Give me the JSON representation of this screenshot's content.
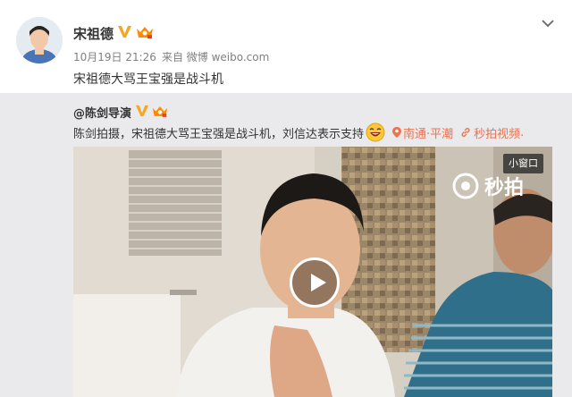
{
  "post": {
    "author": "宋祖德",
    "timestamp": "10月19日 21:26",
    "source": "来自 微博 weibo.com",
    "text": "宋祖德大骂王宝强是战斗机"
  },
  "repost": {
    "author": "@陈剑导演",
    "text": "陈剑拍摄，宋祖德大骂王宝强是战斗机，刘信达表示支持",
    "location": "南通·平潮",
    "video_link": "秒拍视频",
    "trailing_dot": "."
  },
  "video": {
    "brand": "秒拍",
    "small_window_label": "小窗口"
  },
  "colors": {
    "link": "#eb7350",
    "verified": "#f6a623",
    "repost_bg": "#eaeaec"
  }
}
